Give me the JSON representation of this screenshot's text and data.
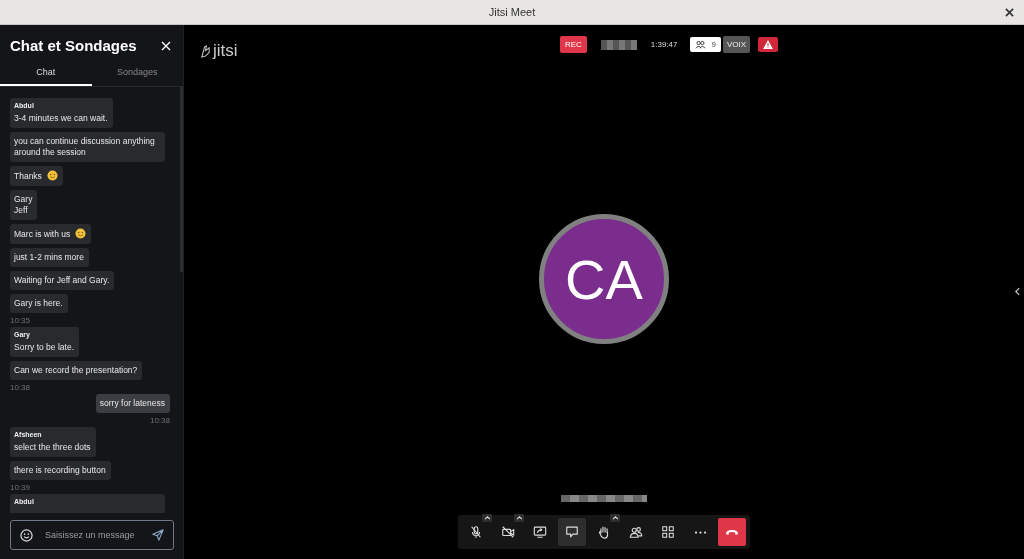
{
  "window": {
    "title": "Jitsi Meet"
  },
  "sidebar": {
    "title": "Chat et Sondages",
    "tabs": [
      {
        "label": "Chat",
        "selected": true
      },
      {
        "label": "Sondages",
        "selected": false
      }
    ],
    "groups": [
      {
        "sender": "Abdul",
        "local": false,
        "time": "10:35",
        "messages": [
          {
            "text": "3-4 minutes we can wait.",
            "emoji": false
          },
          {
            "text": "you can continue discussion anything around the session",
            "emoji": false
          },
          {
            "text": "Thanks",
            "emoji": true
          },
          {
            "text": "Gary\nJeff",
            "emoji": false
          },
          {
            "text": "Marc is with us",
            "emoji": true
          },
          {
            "text": "just 1-2 mins more",
            "emoji": false
          },
          {
            "text": "Waiting for Jeff and Gary.",
            "emoji": false
          },
          {
            "text": "Gary is here.",
            "emoji": false
          }
        ]
      },
      {
        "sender": "Gary",
        "local": false,
        "time": "10:38",
        "messages": [
          {
            "text": "Sorry to be late.",
            "emoji": false
          },
          {
            "text": "Can we record the presentation?",
            "emoji": false
          }
        ]
      },
      {
        "local": true,
        "time": "10:38",
        "messages": [
          {
            "text": "sorry for lateness",
            "emoji": false
          }
        ]
      },
      {
        "sender": "Afsheen",
        "local": false,
        "time": "10:39",
        "messages": [
          {
            "text": "select the three dots",
            "emoji": false
          },
          {
            "text": "there is recording button",
            "emoji": false
          }
        ]
      },
      {
        "sender": "Abdul",
        "local": false
      }
    ],
    "input": {
      "placeholder": "Saisissez un message"
    }
  },
  "stage": {
    "logo": "jitsi",
    "rec": "REC",
    "duration": "1:39:47",
    "participants": "9",
    "audio_label": "VOIX",
    "avatar_initials": "CA"
  },
  "toolbar": [
    {
      "kind": "mic",
      "selected": false,
      "menu": true
    },
    {
      "kind": "camera",
      "selected": false,
      "menu": true
    },
    {
      "kind": "screen",
      "selected": false,
      "menu": false
    },
    {
      "kind": "chat",
      "selected": true,
      "menu": false
    },
    {
      "kind": "hand",
      "selected": false,
      "menu": true
    },
    {
      "kind": "people",
      "selected": false,
      "menu": false
    },
    {
      "kind": "grid",
      "selected": false,
      "menu": false
    },
    {
      "kind": "more",
      "selected": false,
      "menu": false
    },
    {
      "kind": "hangup",
      "selected": false,
      "menu": false
    }
  ]
}
